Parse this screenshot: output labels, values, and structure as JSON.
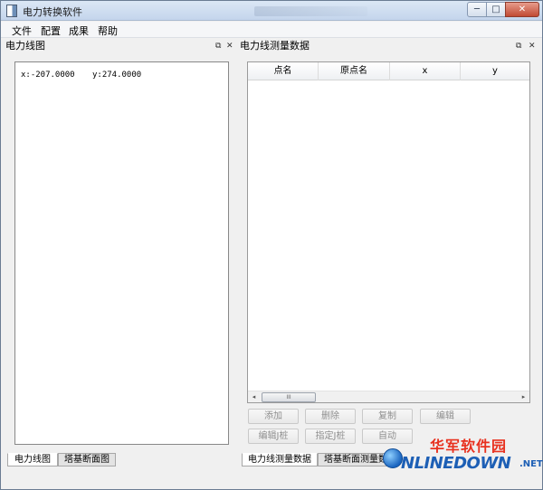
{
  "window": {
    "title": "电力转换软件",
    "controls": {
      "minimize": "─",
      "maximize": "□",
      "close": "✕"
    }
  },
  "menu": [
    "文件",
    "配置",
    "成果",
    "帮助"
  ],
  "left_dock": {
    "title": "电力线图",
    "float_icon": "⧉",
    "close_icon": "✕",
    "coords": {
      "x": "x:-207.0000",
      "y": "y:274.0000"
    },
    "tabs": [
      "电力线图",
      "塔基断面图"
    ]
  },
  "right_dock": {
    "title": "电力线测量数据",
    "float_icon": "⧉",
    "close_icon": "✕",
    "table": {
      "columns": [
        "点名",
        "原点名",
        "x",
        "y"
      ],
      "rows": []
    },
    "scroll": {
      "left": "◂",
      "thumb": "III",
      "right": "▸"
    },
    "buttons_row1": [
      "添加",
      "删除",
      "复制",
      "编辑"
    ],
    "buttons_row2": [
      "编辑J桩",
      "指定J桩",
      "自动"
    ],
    "tabs": [
      "电力线测量数据",
      "塔基断面测量数"
    ]
  },
  "watermark": {
    "cn": "华军软件园",
    "en": "NLINEDOWN",
    "net": ".NET"
  }
}
